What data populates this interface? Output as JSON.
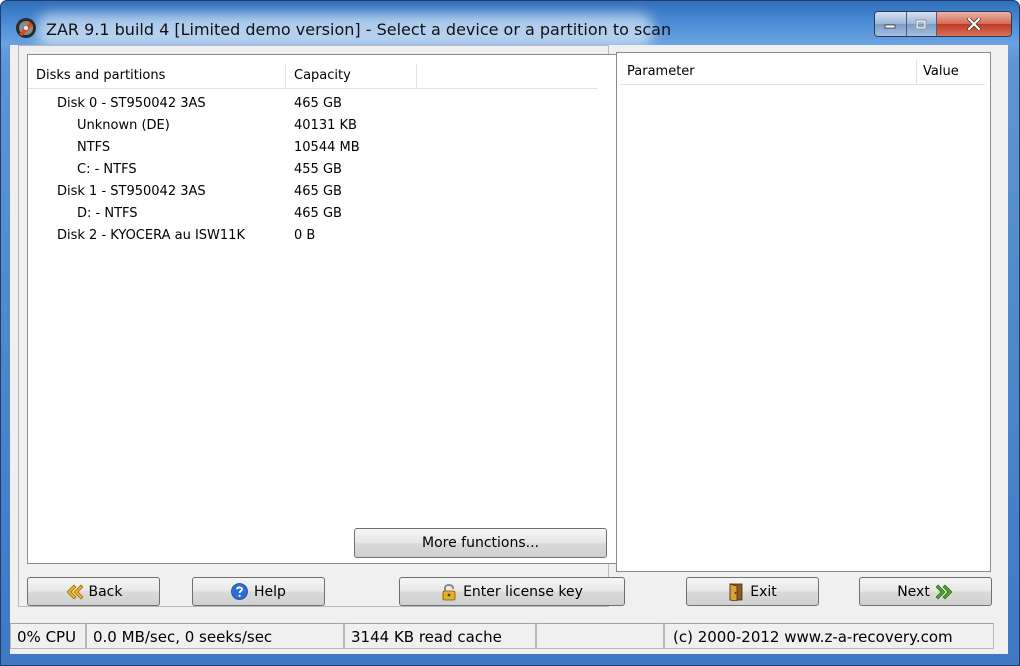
{
  "window": {
    "title": "ZAR 9.1 build 4 [Limited demo version] - Select a device or a partition to scan"
  },
  "disks_list": {
    "columns": [
      "Disks and partitions",
      "Capacity"
    ],
    "rows": [
      {
        "name": "Disk 0 - ST950042 3AS",
        "capacity": "465 GB",
        "level": 1
      },
      {
        "name": "Unknown (DE)",
        "capacity": "40131 KB",
        "level": 2
      },
      {
        "name": "NTFS",
        "capacity": "10544 MB",
        "level": 2
      },
      {
        "name": "C: - NTFS",
        "capacity": "455 GB",
        "level": 2
      },
      {
        "name": "Disk 1 - ST950042 3AS",
        "capacity": "465 GB",
        "level": 1
      },
      {
        "name": "D: - NTFS",
        "capacity": "465 GB",
        "level": 2
      },
      {
        "name": "Disk 2 - KYOCERA au ISW11K",
        "capacity": "0 B",
        "level": 1
      }
    ]
  },
  "params_list": {
    "columns": [
      "Parameter",
      "Value"
    ]
  },
  "buttons": {
    "more_functions": "More functions...",
    "back": "Back",
    "help": "Help",
    "license": "Enter license key",
    "exit": "Exit",
    "next": "Next"
  },
  "statusbar": {
    "cpu": "0% CPU",
    "io": "0.0 MB/sec, 0 seeks/sec",
    "cache": "3144 KB read cache",
    "copyright": "(c) 2000-2012 www.z-a-recovery.com"
  },
  "icons": {
    "app": "zar-app-icon",
    "back": "double-chevron-left-icon",
    "help": "question-circle-icon",
    "license": "padlock-icon",
    "exit": "door-exit-icon",
    "next": "double-chevron-right-icon"
  },
  "colors": {
    "frame": "#4a8ad4",
    "close_button": "#c23a21",
    "chevron_green": "#4aa52a"
  }
}
